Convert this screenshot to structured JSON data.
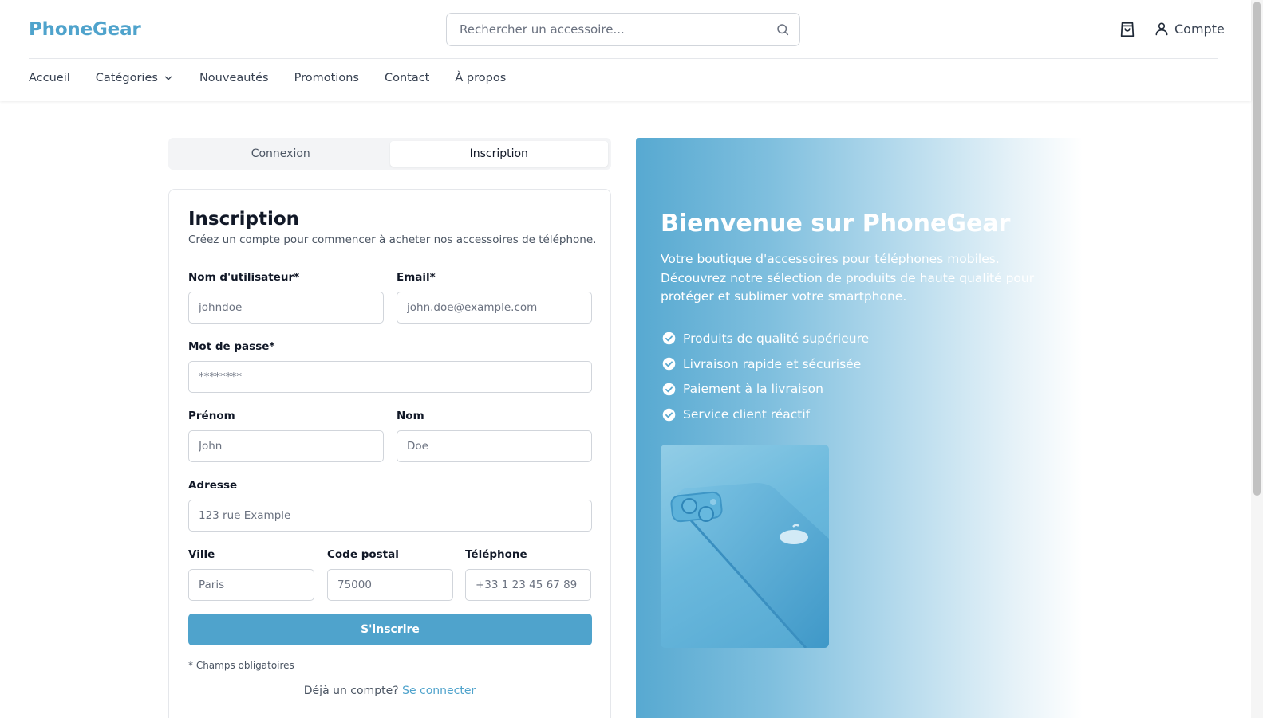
{
  "header": {
    "logo": "PhoneGear",
    "search_placeholder": "Rechercher un accessoire...",
    "account_label": "Compte"
  },
  "nav": {
    "items": [
      {
        "label": "Accueil"
      },
      {
        "label": "Catégories"
      },
      {
        "label": "Nouveautés"
      },
      {
        "label": "Promotions"
      },
      {
        "label": "Contact"
      },
      {
        "label": "À propos"
      }
    ]
  },
  "tabs": [
    {
      "label": "Connexion",
      "active": false
    },
    {
      "label": "Inscription",
      "active": true
    }
  ],
  "form": {
    "title": "Inscription",
    "subtitle": "Créez un compte pour commencer à acheter nos accessoires de téléphone.",
    "fields": {
      "username": {
        "label": "Nom d'utilisateur*",
        "placeholder": "johndoe",
        "value": ""
      },
      "email": {
        "label": "Email*",
        "placeholder": "john.doe@example.com",
        "value": ""
      },
      "password": {
        "label": "Mot de passe*",
        "placeholder": "********",
        "value": ""
      },
      "first_name": {
        "label": "Prénom",
        "placeholder": "John",
        "value": ""
      },
      "last_name": {
        "label": "Nom",
        "placeholder": "Doe",
        "value": ""
      },
      "address": {
        "label": "Adresse",
        "placeholder": "123 rue Example",
        "value": ""
      },
      "city": {
        "label": "Ville",
        "placeholder": "Paris",
        "value": ""
      },
      "postal_code": {
        "label": "Code postal",
        "placeholder": "75000",
        "value": ""
      },
      "phone": {
        "label": "Téléphone",
        "placeholder": "+33 1 23 45 67 89",
        "value": ""
      }
    },
    "submit_label": "S'inscrire",
    "required_note": "* Champs obligatoires",
    "login_prompt": "Déjà un compte?",
    "login_link": "Se connecter"
  },
  "hero": {
    "title": "Bienvenue sur PhoneGear",
    "description": "Votre boutique d'accessoires pour téléphones mobiles. Découvrez notre sélection de produits de haute qualité pour protéger et sublimer votre smartphone.",
    "features": [
      "Produits de qualité supérieure",
      "Livraison rapide et sécurisée",
      "Paiement à la livraison",
      "Service client réactif"
    ]
  },
  "colors": {
    "brand": "#4fa3cc",
    "text": "#111827",
    "muted": "#4b5563",
    "border": "#d1d5db"
  },
  "icons": [
    "search-icon",
    "shopping-bag-icon",
    "user-icon",
    "chevron-down-icon",
    "check-circle-icon"
  ]
}
